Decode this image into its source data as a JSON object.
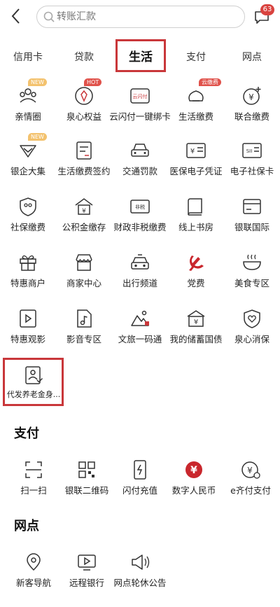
{
  "header": {
    "search_placeholder": "转账汇款",
    "message_count": "63"
  },
  "tabs": [
    {
      "label": "信用卡"
    },
    {
      "label": "贷款"
    },
    {
      "label": "生活",
      "active": true
    },
    {
      "label": "支付"
    },
    {
      "label": "网点"
    }
  ],
  "life_items": [
    {
      "label": "亲情圈",
      "icon": "family-icon",
      "tag": "NEW"
    },
    {
      "label": "泉心权益",
      "icon": "benefit-icon",
      "tag": "HOT"
    },
    {
      "label": "云闪付一键绑卡",
      "icon": "cloud-pay-card-icon",
      "icon_text": "云闪付"
    },
    {
      "label": "生活缴费",
      "icon": "life-pay-icon",
      "tag": "云缴费"
    },
    {
      "label": "联合缴费",
      "icon": "joint-pay-icon"
    },
    {
      "label": "银企大集",
      "icon": "bank-enterprise-icon",
      "tag": "NEW"
    },
    {
      "label": "生活缴费签约",
      "icon": "pay-contract-icon"
    },
    {
      "label": "交通罚款",
      "icon": "traffic-fine-icon"
    },
    {
      "label": "医保电子凭证",
      "icon": "medical-voucher-icon"
    },
    {
      "label": "电子社保卡",
      "icon": "social-card-icon",
      "icon_text": "SII"
    },
    {
      "label": "社保缴费",
      "icon": "social-pay-icon"
    },
    {
      "label": "公积金缴存",
      "icon": "housing-fund-icon"
    },
    {
      "label": "财政非税缴费",
      "icon": "finance-tax-icon",
      "icon_text": "非税"
    },
    {
      "label": "线上书房",
      "icon": "book-icon"
    },
    {
      "label": "银联国际",
      "icon": "unionpay-intl-icon"
    },
    {
      "label": "特惠商户",
      "icon": "gift-icon"
    },
    {
      "label": "商家中心",
      "icon": "shop-icon"
    },
    {
      "label": "出行频道",
      "icon": "car-icon"
    },
    {
      "label": "党费",
      "icon": "party-icon"
    },
    {
      "label": "美食专区",
      "icon": "food-icon"
    },
    {
      "label": "特惠观影",
      "icon": "movie-icon"
    },
    {
      "label": "影音专区",
      "icon": "music-icon"
    },
    {
      "label": "文旅一码通",
      "icon": "travel-icon"
    },
    {
      "label": "我的储蓄国债",
      "icon": "bond-icon"
    },
    {
      "label": "泉心消保",
      "icon": "shield-heart-icon"
    },
    {
      "label": "代发养老金身...",
      "icon": "pension-id-icon"
    }
  ],
  "pay_section": {
    "title": "支付",
    "items": [
      {
        "label": "扫一扫",
        "icon": "scan-icon"
      },
      {
        "label": "银联二维码",
        "icon": "qrcode-icon"
      },
      {
        "label": "闪付充值",
        "icon": "flash-pay-icon"
      },
      {
        "label": "数字人民币",
        "icon": "digital-rmb-icon"
      },
      {
        "label": "e齐付支付",
        "icon": "epay-icon"
      }
    ]
  },
  "branch_section": {
    "title": "网点",
    "items": [
      {
        "label": "新客导航",
        "icon": "location-icon"
      },
      {
        "label": "远程银行",
        "icon": "video-bank-icon"
      },
      {
        "label": "网点轮休公告",
        "icon": "announcement-icon"
      }
    ]
  },
  "colors": {
    "accent": "#c9373a",
    "icon_stroke": "#333333",
    "party_red": "#c9272d"
  }
}
